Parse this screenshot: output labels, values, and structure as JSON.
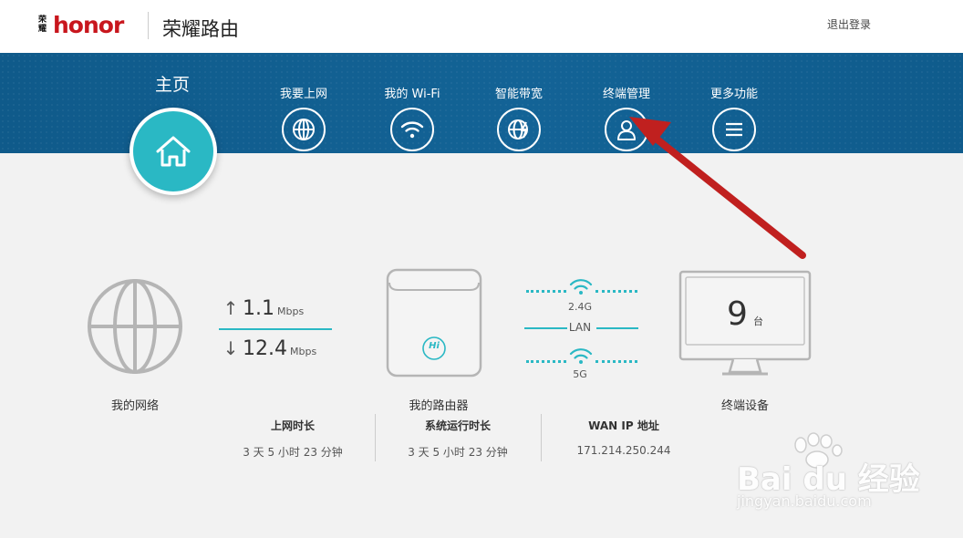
{
  "header": {
    "brand_mark": "荣耀",
    "brand_word": "honor",
    "app_title": "荣耀路由",
    "logout": "退出登录"
  },
  "nav": {
    "home": "主页",
    "items": [
      {
        "label": "我要上网",
        "icon": "globe-icon"
      },
      {
        "label": "我的 Wi-Fi",
        "icon": "wifi-icon"
      },
      {
        "label": "智能带宽",
        "icon": "bandwidth-icon"
      },
      {
        "label": "终端管理",
        "icon": "user-icon"
      },
      {
        "label": "更多功能",
        "icon": "menu-icon"
      }
    ]
  },
  "network": {
    "label": "我的网络",
    "upload_value": "1.1",
    "upload_unit": "Mbps",
    "download_value": "12.4",
    "download_unit": "Mbps"
  },
  "router": {
    "label": "我的路由器",
    "badge": "Hi",
    "band_24": "2.4G",
    "lan": "LAN",
    "band_5": "5G"
  },
  "devices": {
    "count": "9",
    "unit": "台",
    "label": "终端设备"
  },
  "stats": [
    {
      "title": "上网时长",
      "value": "3 天 5 小时 23 分钟"
    },
    {
      "title": "系统运行时长",
      "value": "3 天 5 小时 23 分钟"
    },
    {
      "title": "WAN IP 地址",
      "value": "171.214.250.244"
    }
  ],
  "watermark": {
    "text": "Bai du 经验",
    "sub": "jingyan.baidu.com"
  },
  "colors": {
    "nav_band": "#136396",
    "accent": "#2ab8c4",
    "annotation_arrow": "#c0201f",
    "brand_red": "#c8161d"
  }
}
